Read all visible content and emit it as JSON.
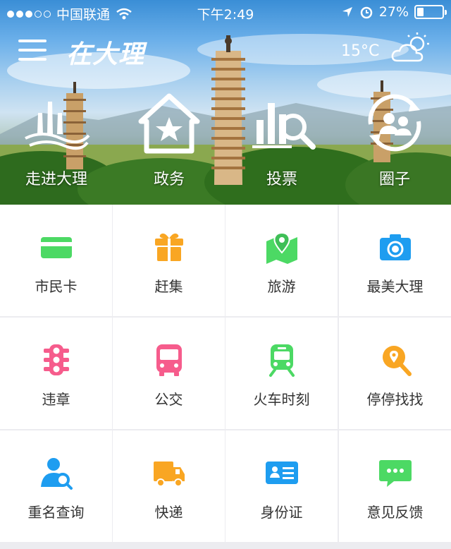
{
  "status_bar": {
    "carrier": "中国联通",
    "time": "下午2:49",
    "battery": "27%",
    "battery_level": 0.27,
    "signal_bars_filled": 3,
    "signal_bars_total": 5
  },
  "header": {
    "brand": "在大理",
    "temperature": "15°C",
    "weather_icon": "partly-cloudy-sun-icon",
    "menu_icon": "hamburger-menu-icon"
  },
  "nav": {
    "items": [
      {
        "label": "走进大理",
        "icon": "pagoda-lake-icon"
      },
      {
        "label": "政务",
        "icon": "house-star-icon"
      },
      {
        "label": "投票",
        "icon": "chart-magnifier-icon"
      },
      {
        "label": "圈子",
        "icon": "people-circle-icon"
      }
    ]
  },
  "services": {
    "items": [
      {
        "label": "市民卡",
        "icon": "card-icon",
        "color": "#4cd964"
      },
      {
        "label": "赶集",
        "icon": "gift-icon",
        "color": "#f9a623"
      },
      {
        "label": "旅游",
        "icon": "map-pin-icon",
        "color": "#4cd964"
      },
      {
        "label": "最美大理",
        "icon": "camera-icon",
        "color": "#1e9df0"
      },
      {
        "label": "违章",
        "icon": "traffic-light-icon",
        "color": "#f65c8c"
      },
      {
        "label": "公交",
        "icon": "bus-icon",
        "color": "#f65c8c"
      },
      {
        "label": "火车时刻",
        "icon": "train-icon",
        "color": "#4cd964"
      },
      {
        "label": "停停找找",
        "icon": "parking-search-icon",
        "color": "#f9a623"
      },
      {
        "label": "重名查询",
        "icon": "person-search-icon",
        "color": "#1e9df0"
      },
      {
        "label": "快递",
        "icon": "delivery-truck-icon",
        "color": "#f9a623"
      },
      {
        "label": "身份证",
        "icon": "id-card-icon",
        "color": "#1e9df0"
      },
      {
        "label": "意见反馈",
        "icon": "feedback-bubble-icon",
        "color": "#4cd964"
      }
    ]
  }
}
